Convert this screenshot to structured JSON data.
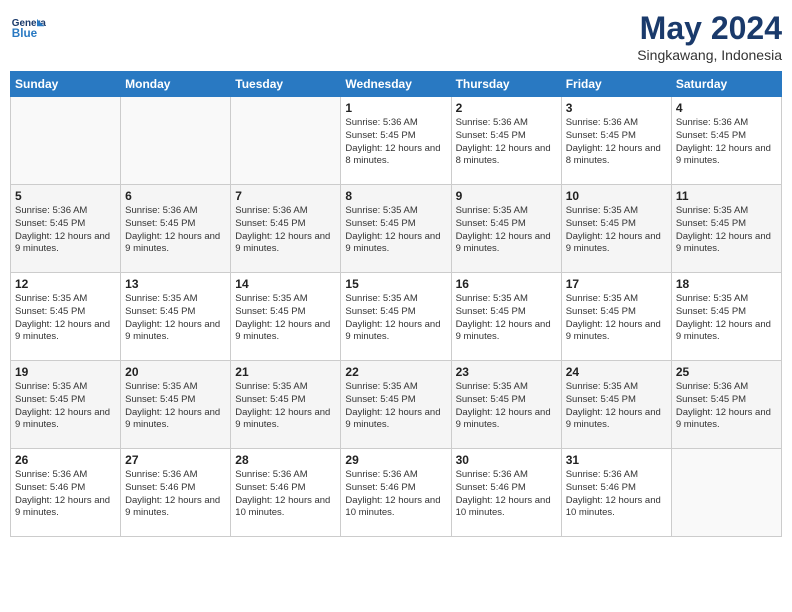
{
  "header": {
    "logo_line1": "General",
    "logo_line2": "Blue",
    "month": "May 2024",
    "location": "Singkawang, Indonesia"
  },
  "weekdays": [
    "Sunday",
    "Monday",
    "Tuesday",
    "Wednesday",
    "Thursday",
    "Friday",
    "Saturday"
  ],
  "weeks": [
    [
      {
        "day": "",
        "info": ""
      },
      {
        "day": "",
        "info": ""
      },
      {
        "day": "",
        "info": ""
      },
      {
        "day": "1",
        "info": "Sunrise: 5:36 AM\nSunset: 5:45 PM\nDaylight: 12 hours\nand 8 minutes."
      },
      {
        "day": "2",
        "info": "Sunrise: 5:36 AM\nSunset: 5:45 PM\nDaylight: 12 hours\nand 8 minutes."
      },
      {
        "day": "3",
        "info": "Sunrise: 5:36 AM\nSunset: 5:45 PM\nDaylight: 12 hours\nand 8 minutes."
      },
      {
        "day": "4",
        "info": "Sunrise: 5:36 AM\nSunset: 5:45 PM\nDaylight: 12 hours\nand 9 minutes."
      }
    ],
    [
      {
        "day": "5",
        "info": "Sunrise: 5:36 AM\nSunset: 5:45 PM\nDaylight: 12 hours\nand 9 minutes."
      },
      {
        "day": "6",
        "info": "Sunrise: 5:36 AM\nSunset: 5:45 PM\nDaylight: 12 hours\nand 9 minutes."
      },
      {
        "day": "7",
        "info": "Sunrise: 5:36 AM\nSunset: 5:45 PM\nDaylight: 12 hours\nand 9 minutes."
      },
      {
        "day": "8",
        "info": "Sunrise: 5:35 AM\nSunset: 5:45 PM\nDaylight: 12 hours\nand 9 minutes."
      },
      {
        "day": "9",
        "info": "Sunrise: 5:35 AM\nSunset: 5:45 PM\nDaylight: 12 hours\nand 9 minutes."
      },
      {
        "day": "10",
        "info": "Sunrise: 5:35 AM\nSunset: 5:45 PM\nDaylight: 12 hours\nand 9 minutes."
      },
      {
        "day": "11",
        "info": "Sunrise: 5:35 AM\nSunset: 5:45 PM\nDaylight: 12 hours\nand 9 minutes."
      }
    ],
    [
      {
        "day": "12",
        "info": "Sunrise: 5:35 AM\nSunset: 5:45 PM\nDaylight: 12 hours\nand 9 minutes."
      },
      {
        "day": "13",
        "info": "Sunrise: 5:35 AM\nSunset: 5:45 PM\nDaylight: 12 hours\nand 9 minutes."
      },
      {
        "day": "14",
        "info": "Sunrise: 5:35 AM\nSunset: 5:45 PM\nDaylight: 12 hours\nand 9 minutes."
      },
      {
        "day": "15",
        "info": "Sunrise: 5:35 AM\nSunset: 5:45 PM\nDaylight: 12 hours\nand 9 minutes."
      },
      {
        "day": "16",
        "info": "Sunrise: 5:35 AM\nSunset: 5:45 PM\nDaylight: 12 hours\nand 9 minutes."
      },
      {
        "day": "17",
        "info": "Sunrise: 5:35 AM\nSunset: 5:45 PM\nDaylight: 12 hours\nand 9 minutes."
      },
      {
        "day": "18",
        "info": "Sunrise: 5:35 AM\nSunset: 5:45 PM\nDaylight: 12 hours\nand 9 minutes."
      }
    ],
    [
      {
        "day": "19",
        "info": "Sunrise: 5:35 AM\nSunset: 5:45 PM\nDaylight: 12 hours\nand 9 minutes."
      },
      {
        "day": "20",
        "info": "Sunrise: 5:35 AM\nSunset: 5:45 PM\nDaylight: 12 hours\nand 9 minutes."
      },
      {
        "day": "21",
        "info": "Sunrise: 5:35 AM\nSunset: 5:45 PM\nDaylight: 12 hours\nand 9 minutes."
      },
      {
        "day": "22",
        "info": "Sunrise: 5:35 AM\nSunset: 5:45 PM\nDaylight: 12 hours\nand 9 minutes."
      },
      {
        "day": "23",
        "info": "Sunrise: 5:35 AM\nSunset: 5:45 PM\nDaylight: 12 hours\nand 9 minutes."
      },
      {
        "day": "24",
        "info": "Sunrise: 5:35 AM\nSunset: 5:45 PM\nDaylight: 12 hours\nand 9 minutes."
      },
      {
        "day": "25",
        "info": "Sunrise: 5:36 AM\nSunset: 5:45 PM\nDaylight: 12 hours\nand 9 minutes."
      }
    ],
    [
      {
        "day": "26",
        "info": "Sunrise: 5:36 AM\nSunset: 5:46 PM\nDaylight: 12 hours\nand 9 minutes."
      },
      {
        "day": "27",
        "info": "Sunrise: 5:36 AM\nSunset: 5:46 PM\nDaylight: 12 hours\nand 9 minutes."
      },
      {
        "day": "28",
        "info": "Sunrise: 5:36 AM\nSunset: 5:46 PM\nDaylight: 12 hours\nand 10 minutes."
      },
      {
        "day": "29",
        "info": "Sunrise: 5:36 AM\nSunset: 5:46 PM\nDaylight: 12 hours\nand 10 minutes."
      },
      {
        "day": "30",
        "info": "Sunrise: 5:36 AM\nSunset: 5:46 PM\nDaylight: 12 hours\nand 10 minutes."
      },
      {
        "day": "31",
        "info": "Sunrise: 5:36 AM\nSunset: 5:46 PM\nDaylight: 12 hours\nand 10 minutes."
      },
      {
        "day": "",
        "info": ""
      }
    ]
  ]
}
